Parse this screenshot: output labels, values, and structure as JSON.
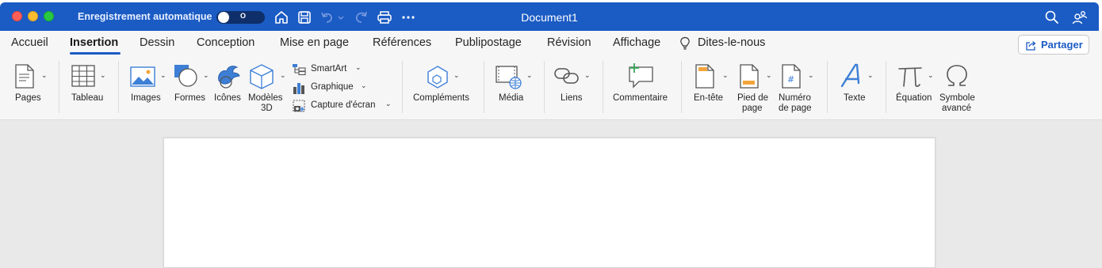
{
  "titlebar": {
    "autosave_label": "Enregistrement automatique",
    "autosave_state": "O",
    "autosave_on": false,
    "document_title": "Document1",
    "bar_color": "#1b5bc4"
  },
  "tabs": [
    {
      "label": "Accueil"
    },
    {
      "label": "Insertion",
      "active": true
    },
    {
      "label": "Dessin"
    },
    {
      "label": "Conception"
    },
    {
      "label": "Mise en page"
    },
    {
      "label": "Références"
    },
    {
      "label": "Publipostage"
    },
    {
      "label": "Révision"
    },
    {
      "label": "Affichage"
    },
    {
      "label": "Dites-le-nous",
      "icon": "lightbulb-icon"
    }
  ],
  "share": {
    "label": "Partager",
    "icon": "share-icon"
  },
  "ribbon": {
    "pages": {
      "label": "Pages",
      "icon": "page-icon"
    },
    "tableau": {
      "label": "Tableau",
      "icon": "table-icon"
    },
    "images": {
      "label": "Images",
      "icon": "picture-icon"
    },
    "formes": {
      "label": "Formes",
      "icon": "shapes-icon"
    },
    "icones": {
      "label": "Icônes",
      "icon": "bird-icon"
    },
    "modeles3d": {
      "label1": "Modèles",
      "label2": "3D",
      "icon": "cube-icon"
    },
    "smartart": {
      "label": "SmartArt",
      "icon": "smartart-icon"
    },
    "graphique": {
      "label": "Graphique",
      "icon": "chart-icon"
    },
    "capture": {
      "label": "Capture d'écran",
      "icon": "screenshot-icon"
    },
    "complements": {
      "label": "Compléments",
      "icon": "hexagon-icon"
    },
    "media": {
      "label": "Média",
      "icon": "media-icon"
    },
    "liens": {
      "label": "Liens",
      "icon": "link-icon"
    },
    "commentaire": {
      "label": "Commentaire",
      "icon": "comment-icon"
    },
    "entete": {
      "label": "En-tête",
      "icon": "header-icon"
    },
    "pied": {
      "label1": "Pied de",
      "label2": "page",
      "icon": "footer-icon"
    },
    "numero": {
      "label1": "Numéro",
      "label2": "de page",
      "icon": "page-number-icon"
    },
    "texte": {
      "label": "Texte",
      "icon": "text-icon"
    },
    "equation": {
      "label": "Équation",
      "icon": "pi-icon"
    },
    "symbole": {
      "label1": "Symbole",
      "label2": "avancé",
      "icon": "omega-icon"
    }
  },
  "colors": {
    "accent": "#1b5bc4",
    "canvas": "#e9e9e9",
    "ribbon": "#f6f6f6"
  }
}
